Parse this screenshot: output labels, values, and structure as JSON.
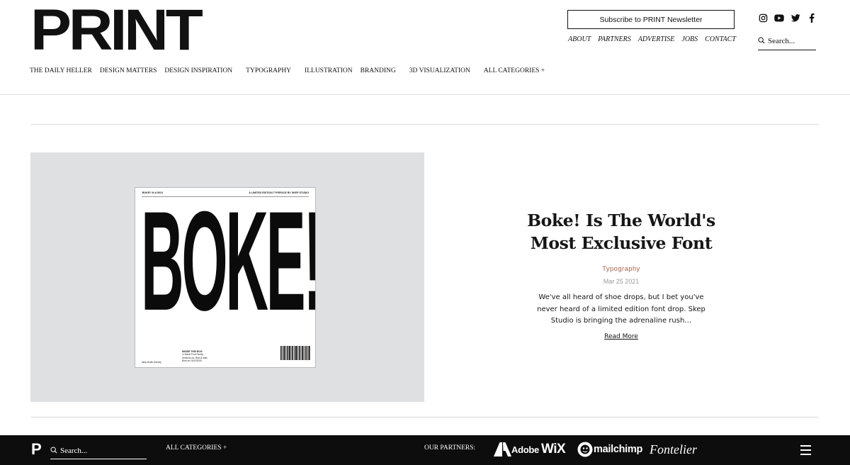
{
  "brand": {
    "logo_text": "PRINT"
  },
  "header": {
    "subscribe_label": "Subscribe to PRINT Newsletter",
    "social_icons": [
      "instagram-icon",
      "youtube-icon",
      "twitter-icon",
      "facebook-icon"
    ],
    "top_links": [
      "ABOUT",
      "PARTNERS",
      "ADVERTISE",
      "JOBS",
      "CONTACT"
    ],
    "search_placeholder": "Search..."
  },
  "category_nav": [
    "THE DAILY HELLER",
    "DESIGN MATTERS",
    "DESIGN INSPIRATION",
    "TYPOGRAPHY",
    "ILLUSTRATION",
    "BRANDING",
    "3D VISUALIZATION",
    "ALL CATEGORIES +"
  ],
  "article": {
    "title": "Boke! Is The World's Most Exclusive Font",
    "category": "Typography",
    "date": "Mar 25 2021",
    "excerpt": "We've all heard of shoe drops, but I bet you've never heard of a limited edition font drop. Skep Studio is bringing the adrenaline rush…",
    "read_more": "Read More",
    "image": {
      "big_word": "BOKE!",
      "top_left": "'BOKE!' IN A BOX",
      "top_right": "A LIMITED EDITION TYPEFACE BY SKEP STUDIO",
      "box_title": "INSIDE THIS BOX:",
      "box_lines": [
        "1x Boke! Font Family",
        "Versions inc: Bold & Italic",
        "Born on 20/12/2020"
      ],
      "studio": "skep studio foundry"
    }
  },
  "footer": {
    "logo": "P",
    "search_placeholder": "Search...",
    "all_categories": "ALL CATEGORIES +",
    "partners_label": "OUR PARTNERS:",
    "partner_logos": [
      "Adobe",
      "WiX",
      "mailchimp",
      "Fontelier"
    ],
    "menu_icon": "hamburger-menu-icon"
  },
  "colors": {
    "accent": "#b2604b",
    "hero_background": "#dfe0e2",
    "footer_background": "#0d0d0d",
    "text": "#111111"
  }
}
